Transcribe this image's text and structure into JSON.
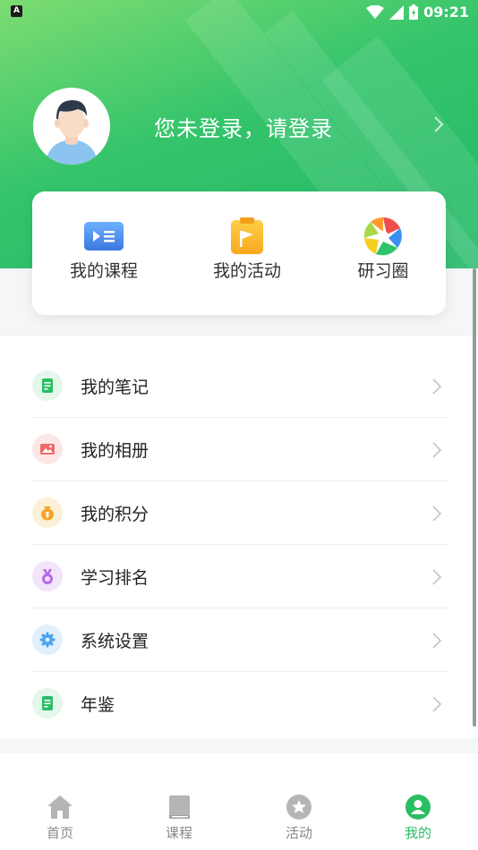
{
  "status_bar": {
    "badge": "A",
    "time": "09:21"
  },
  "profile": {
    "login_prompt": "您未登录，请登录"
  },
  "quick_links": [
    {
      "label": "我的课程",
      "icon": "course-icon"
    },
    {
      "label": "我的活动",
      "icon": "activity-flag-icon"
    },
    {
      "label": "研习圈",
      "icon": "aperture-icon"
    }
  ],
  "menu": [
    {
      "label": "我的笔记",
      "icon": "note-icon",
      "color": "#2bbd62"
    },
    {
      "label": "我的相册",
      "icon": "photo-icon",
      "color": "#f06a6a"
    },
    {
      "label": "我的积分",
      "icon": "points-bag-icon",
      "color": "#f5a524"
    },
    {
      "label": "学习排名",
      "icon": "medal-icon",
      "color": "#b86ae8"
    },
    {
      "label": "系统设置",
      "icon": "gear-icon",
      "color": "#4aa3f0"
    },
    {
      "label": "年鉴",
      "icon": "yearbook-icon",
      "color": "#2bbd62"
    }
  ],
  "tabs": [
    {
      "label": "首页",
      "icon": "home-icon",
      "active": false
    },
    {
      "label": "课程",
      "icon": "book-icon",
      "active": false
    },
    {
      "label": "活动",
      "icon": "star-icon",
      "active": false
    },
    {
      "label": "我的",
      "icon": "user-icon",
      "active": true
    }
  ],
  "colors": {
    "brand_green": "#2bbd62",
    "inactive_gray": "#888888"
  }
}
